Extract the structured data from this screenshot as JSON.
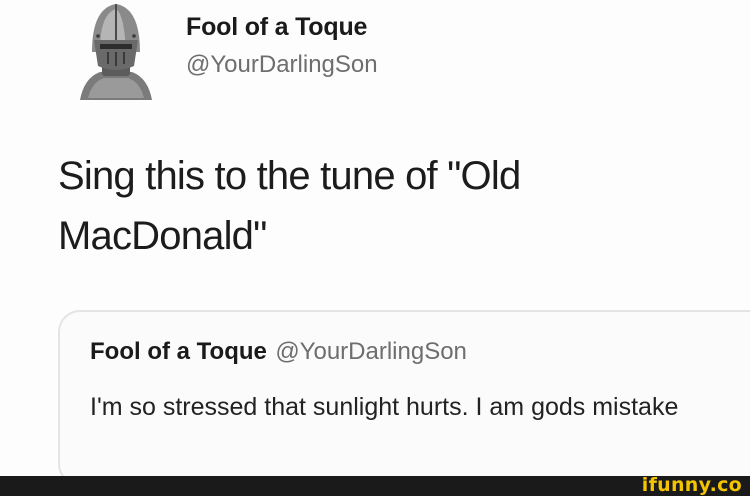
{
  "tweet": {
    "author_name": "Fool of a Toque",
    "author_handle": "@YourDarlingSon",
    "text": "Sing this to the tune of \"Old MacDonald\"",
    "avatar_icon": "knight-helmet-icon"
  },
  "quoted_tweet": {
    "author_name": "Fool of a Toque",
    "author_handle": "@YourDarlingSon",
    "text": "I'm so stressed that sunlight hurts. I am gods mistake"
  },
  "watermark": {
    "text": "ifunny.co",
    "color": "#f4c400"
  }
}
